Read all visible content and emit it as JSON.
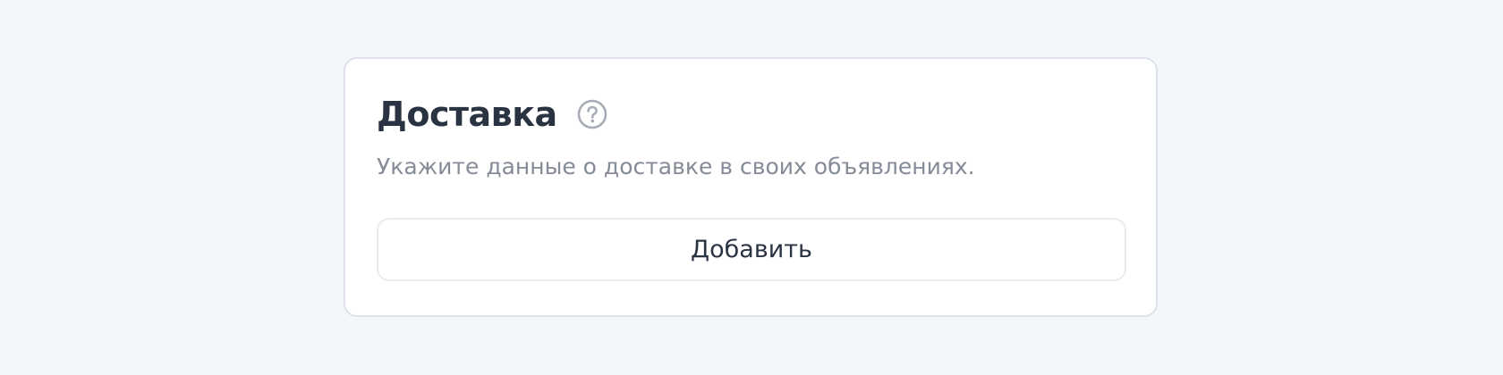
{
  "delivery_card": {
    "title": "Доставка",
    "help_icon": "question-circle-icon",
    "description": "Укажите данные о доставке в своих объявлениях.",
    "add_button_label": "Добавить"
  },
  "colors": {
    "page_background": "#f4f7fa",
    "card_background": "#ffffff",
    "card_border": "#dde2ea",
    "title_text": "#2a3342",
    "description_text": "#858b97",
    "icon_color": "#a7acb6",
    "button_border": "#e9ebef"
  }
}
